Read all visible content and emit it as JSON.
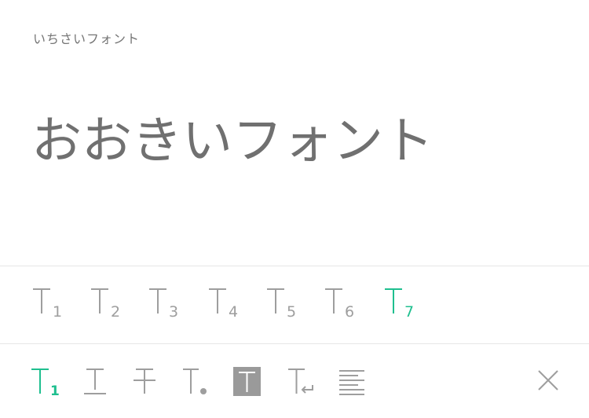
{
  "editor": {
    "small_text": "いちさいフォント",
    "large_text": "おおきいフォント"
  },
  "size_bar": {
    "items": [
      {
        "label": "1",
        "icon": "text-size-1-icon"
      },
      {
        "label": "2",
        "icon": "text-size-2-icon"
      },
      {
        "label": "3",
        "icon": "text-size-3-icon"
      },
      {
        "label": "4",
        "icon": "text-size-4-icon"
      },
      {
        "label": "5",
        "icon": "text-size-5-icon"
      },
      {
        "label": "6",
        "icon": "text-size-6-icon"
      },
      {
        "label": "7",
        "icon": "text-size-7-icon",
        "selected": true
      }
    ]
  },
  "tool_bar": {
    "size_label": "1",
    "tools": [
      "text-size-tool-icon",
      "underline-tool-icon",
      "strikethrough-tool-icon",
      "bullet-tool-icon",
      "highlight-tool-icon",
      "line-break-tool-icon",
      "align-tool-icon",
      "close-icon"
    ]
  },
  "colors": {
    "accent": "#1fbf8f",
    "icon": "#9e9e9e",
    "text_small": "#757575",
    "text_large": "#707070",
    "highlight_fill": "#9a9a9a",
    "divider": "#e6e6e6"
  }
}
